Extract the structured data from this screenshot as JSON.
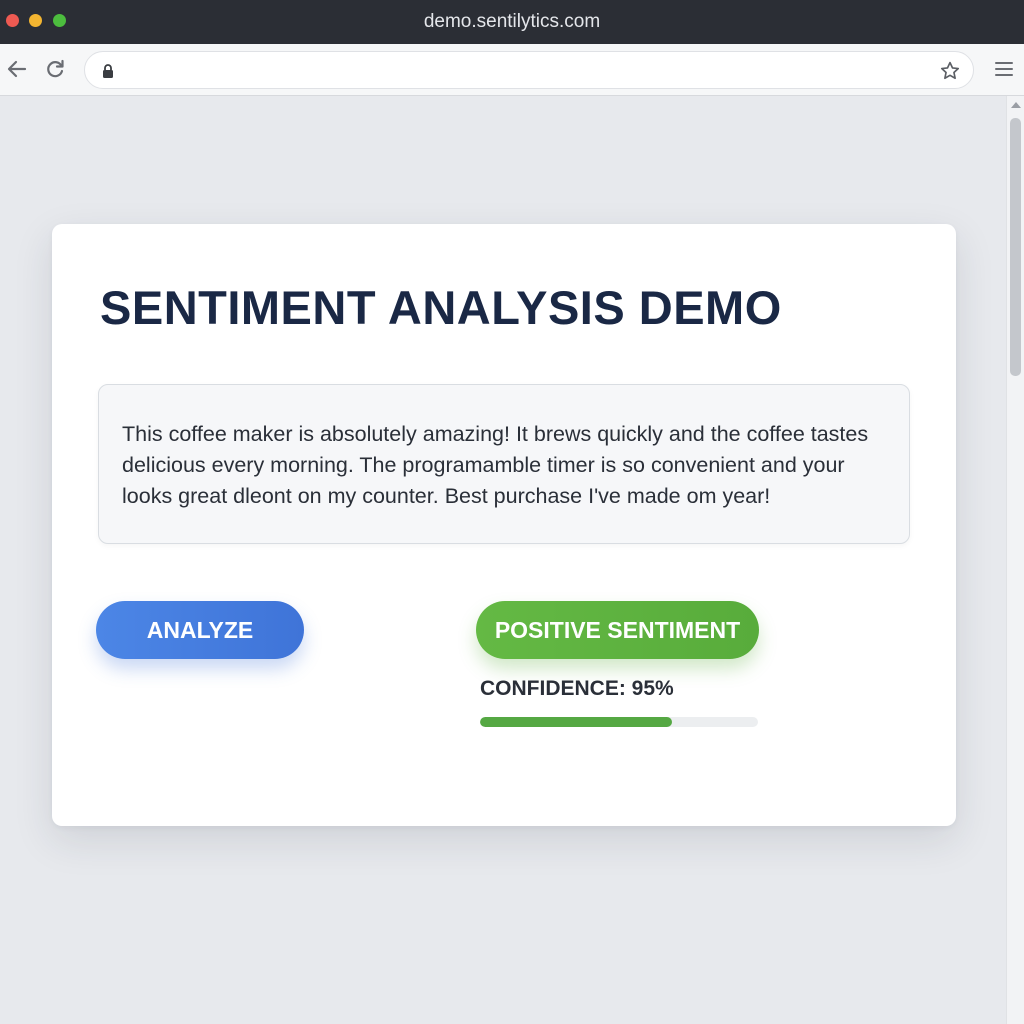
{
  "window": {
    "title": "demo.sentilytics.com"
  },
  "toolbar": {
    "back_icon": "arrow-left-icon",
    "reload_icon": "reload-icon",
    "lock_icon": "lock-icon",
    "bookmark_icon": "star-icon",
    "menu_icon": "hamburger-menu-icon",
    "url_value": ""
  },
  "card": {
    "title": "SENTIMENT ANALYSIS DEMO",
    "review_text": "This coffee maker is absolutely amazing! It brews quickly and the coffee tastes delicious every morning. The programamble timer is so convenient and your looks great dleont on my counter. Best purchase I've made om year!",
    "analyze_label": "ANALYZE",
    "result_label": "POSITIVE SENTIMENT",
    "confidence_label": "CONFIDENCE: 95%",
    "confidence_bar_fraction": 0.69
  },
  "colors": {
    "titlebar": "#2b2e35",
    "heading": "#1a2845",
    "analyze_button": "#4580e0",
    "positive_badge": "#5fb440",
    "confidence_fill": "#55a843"
  }
}
